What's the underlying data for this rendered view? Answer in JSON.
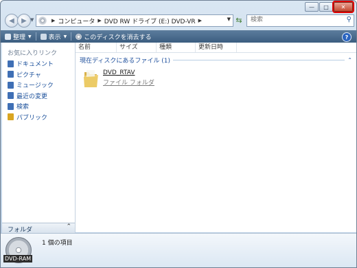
{
  "window": {
    "caption_buttons": [
      {
        "name": "minimize",
        "icon": "minimize-icon",
        "glyph": "—"
      },
      {
        "name": "maximize",
        "icon": "maximize-icon",
        "glyph": "□"
      },
      {
        "name": "close",
        "icon": "close-icon",
        "glyph": "✕"
      }
    ]
  },
  "address_bar": {
    "breadcrumbs": [
      "コンピュータ",
      "DVD RW ドライブ (E:) DVD-VR"
    ]
  },
  "search": {
    "placeholder": "検索"
  },
  "toolbar": {
    "organize_label": "整理",
    "views_label": "表示",
    "erase_label": "このディスクを消去する"
  },
  "left_pane": {
    "favorites_title": "お気に入りリンク",
    "favorites": [
      {
        "label": "ドキュメント",
        "icon": "documents-icon",
        "color": "#3f6fb5"
      },
      {
        "label": "ピクチャ",
        "icon": "pictures-icon",
        "color": "#3f6fb5"
      },
      {
        "label": "ミュージック",
        "icon": "music-icon",
        "color": "#3f6fb5"
      },
      {
        "label": "最近の変更",
        "icon": "recent-changes-icon",
        "color": "#3f6fb5"
      },
      {
        "label": "検索",
        "icon": "search-folder-icon",
        "color": "#3f6fb5"
      },
      {
        "label": "パブリック",
        "icon": "public-icon",
        "color": "#d9a521"
      }
    ],
    "folders_label": "フォルダ"
  },
  "columns": [
    "名前",
    "サイズ",
    "種類",
    "更新日時"
  ],
  "group": {
    "title": "現在ディスクにあるファイル (1)"
  },
  "files": [
    {
      "name": "DVD_RTAV",
      "type": "ファイル フォルダ"
    }
  ],
  "details": {
    "drive_label": "DVD-RAM",
    "item_count": "1 個の項目"
  },
  "colors": {
    "accent_close": "#e00000",
    "toolbar_bg": "#4a6d90",
    "link_blue": "#1a4f9a"
  }
}
